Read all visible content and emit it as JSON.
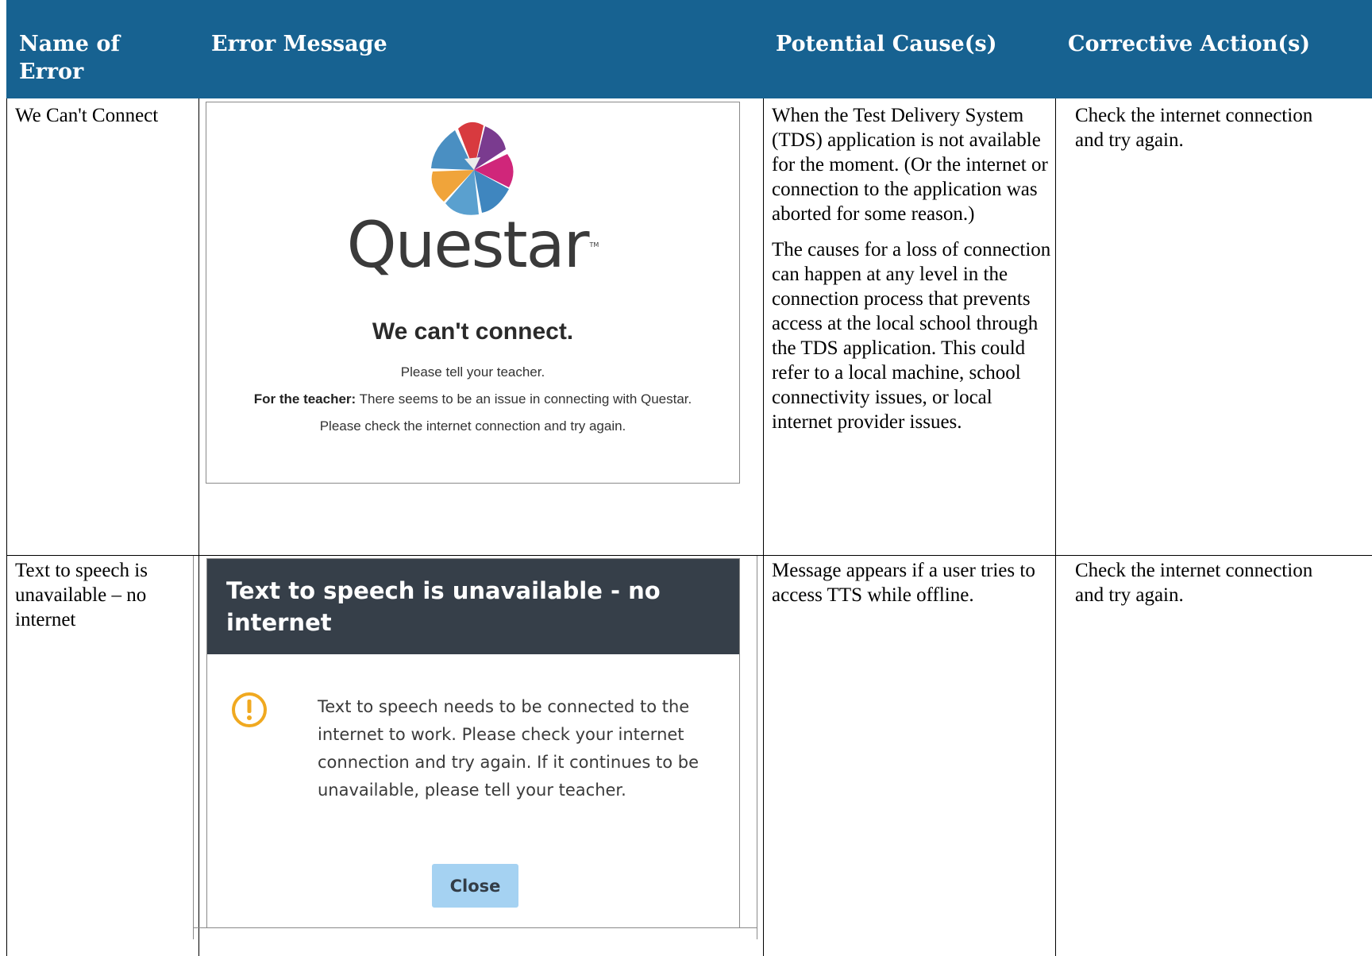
{
  "table": {
    "headers": [
      "Name of Error",
      "Error Message",
      "Potential Cause(s)",
      "Corrective Action(s)"
    ],
    "header_bg": "#176291",
    "rows": [
      {
        "name": "We Can't Connect",
        "cause_paragraphs": [
          "When the Test Delivery System (TDS) application is not available for the moment. (Or the internet or connection to the application was aborted for some reason.)",
          "The causes for a loss of connection can happen at any level in the connection process that prevents access at the local school through the TDS application. This could refer to a local machine, school connectivity issues, or local internet provider issues."
        ],
        "action": "Check the internet connection and try again."
      },
      {
        "name": "Text to speech is unavailable – no internet",
        "cause_paragraphs": [
          "Message appears if a user tries to access TTS while offline."
        ],
        "action": "Check the internet connection and try again."
      }
    ]
  },
  "connect_screen": {
    "brand": "Questar",
    "trademark": "TM",
    "title": "We can't connect.",
    "line1": "Please tell your teacher.",
    "teacher_label": "For the teacher:",
    "teacher_text": " There seems to be an issue in connecting with Questar.",
    "line3": "Please check the internet connection and try again."
  },
  "tts_dialog": {
    "title": "Text to speech is unavailable - no internet",
    "body": "Text to speech needs to be connected to the internet to work. Please check your internet connection and try again. If it continues to be unavailable, please tell your teacher.",
    "close_label": "Close",
    "header_color": "#363f49",
    "warning_color": "#f0a920",
    "button_color": "#a5d2f2",
    "icon": "exclamation-circle-icon"
  }
}
